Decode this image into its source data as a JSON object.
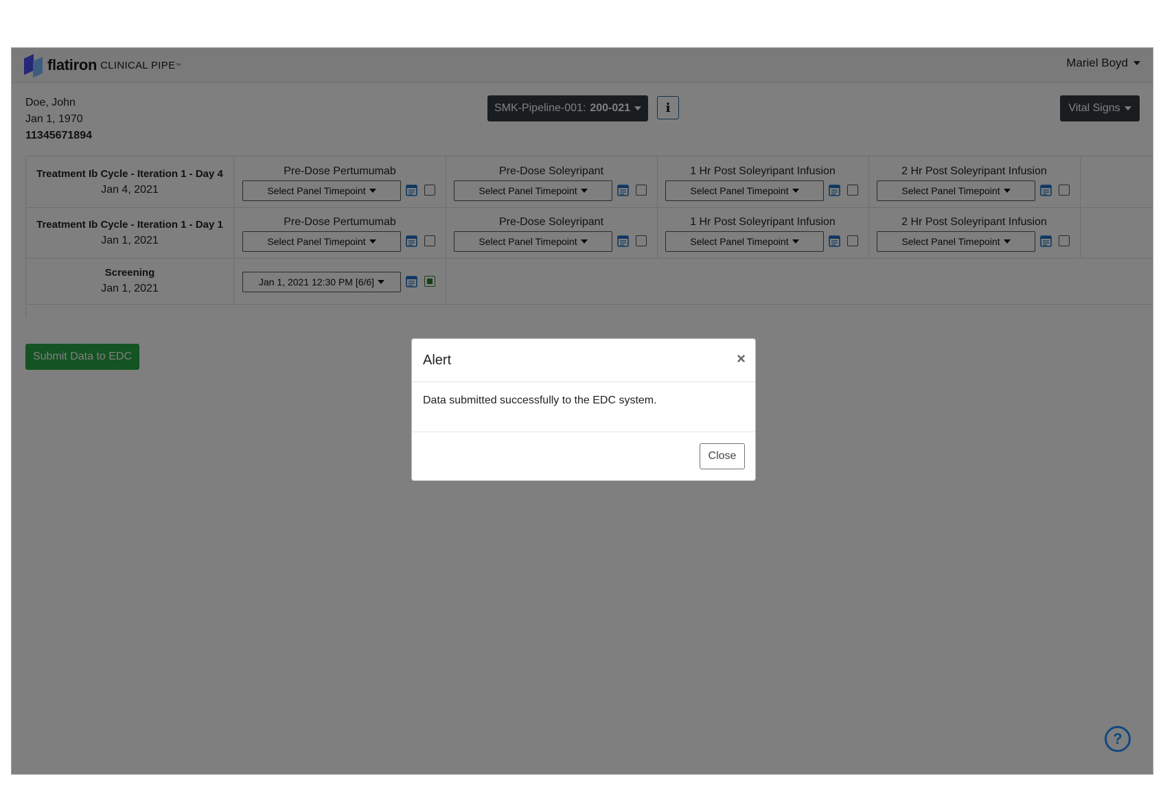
{
  "navbar": {
    "brand": "flatiron",
    "product": "CLINICAL PIPE",
    "trademark": "™",
    "user": "Mariel Boyd"
  },
  "patient": {
    "name": "Doe, John",
    "dob": "Jan 1, 1970",
    "mrn": "11345671894"
  },
  "study": {
    "prefix": "SMK-Pipeline-001:",
    "site": "200-021"
  },
  "info_label": "i",
  "vitals_label": "Vital Signs",
  "rows": [
    {
      "title": "Treatment Ib Cycle - Iteration 1 - Day 4",
      "date": "Jan 4, 2021",
      "cols": [
        {
          "title": "Pre-Dose Pertumumab",
          "select": "Select Panel Timepoint"
        },
        {
          "title": "Pre-Dose Soleyripant",
          "select": "Select Panel Timepoint"
        },
        {
          "title": "1 Hr Post Soleyripant Infusion",
          "select": "Select Panel Timepoint"
        },
        {
          "title": "2 Hr Post Soleyripant Infusion",
          "select": "Select Panel Timepoint"
        }
      ]
    },
    {
      "title": "Treatment Ib Cycle - Iteration 1 - Day 1",
      "date": "Jan 1, 2021",
      "cols": [
        {
          "title": "Pre-Dose Pertumumab",
          "select": "Select Panel Timepoint"
        },
        {
          "title": "Pre-Dose Soleyripant",
          "select": "Select Panel Timepoint"
        },
        {
          "title": "1 Hr Post Soleyripant Infusion",
          "select": "Select Panel Timepoint"
        },
        {
          "title": "2 Hr Post Soleyripant Infusion",
          "select": "Select Panel Timepoint"
        }
      ]
    },
    {
      "title": "Screening",
      "date": "Jan 1, 2021",
      "cols": [
        {
          "title": "",
          "select": "Jan 1, 2021 12:30 PM [6/6]",
          "checked": true
        }
      ]
    }
  ],
  "submit_label": "Submit Data to EDC",
  "help_label": "?",
  "modal": {
    "title": "Alert",
    "close_x": "×",
    "message": "Data submitted successfully to the EDC system.",
    "close_label": "Close"
  },
  "colors": {
    "dark_button": "#343a40",
    "success": "#28a745",
    "icon_blue": "#1e6fc0",
    "help_blue": "#1e90ff"
  }
}
